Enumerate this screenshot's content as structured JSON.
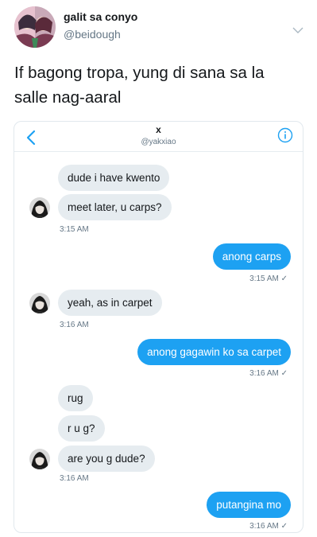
{
  "tweet": {
    "name": "galit sa conyo",
    "handle": "@beidough",
    "text": "If bagong tropa, yung di sana sa la salle nag-aaral"
  },
  "dm": {
    "title": "x",
    "handle": "@yakxiao",
    "messages": [
      {
        "side": "in",
        "text": "dude i have kwento"
      },
      {
        "side": "in",
        "text": "meet later, u carps?"
      },
      {
        "side": "in",
        "time": "3:15 AM"
      },
      {
        "side": "out",
        "text": "anong carps"
      },
      {
        "side": "out",
        "time": "3:15 AM ✓"
      },
      {
        "side": "in",
        "text": "yeah, as in carpet"
      },
      {
        "side": "in",
        "time": "3:16 AM"
      },
      {
        "side": "out",
        "text": "anong gagawin ko sa carpet"
      },
      {
        "side": "out",
        "time": "3:16 AM ✓"
      },
      {
        "side": "in",
        "text": "rug"
      },
      {
        "side": "in",
        "text": "r u g?"
      },
      {
        "side": "in",
        "text": "are you g dude?"
      },
      {
        "side": "in",
        "time": "3:16 AM"
      },
      {
        "side": "out",
        "text": "putangina mo"
      },
      {
        "side": "out",
        "time": "3:16 AM ✓"
      }
    ]
  },
  "colors": {
    "accent": "#1da1f2",
    "incoming_bubble": "#e6ecf0",
    "muted_text": "#657786"
  },
  "icons": [
    "avatar-image",
    "chevron-down-icon",
    "back-arrow-icon",
    "info-icon"
  ]
}
